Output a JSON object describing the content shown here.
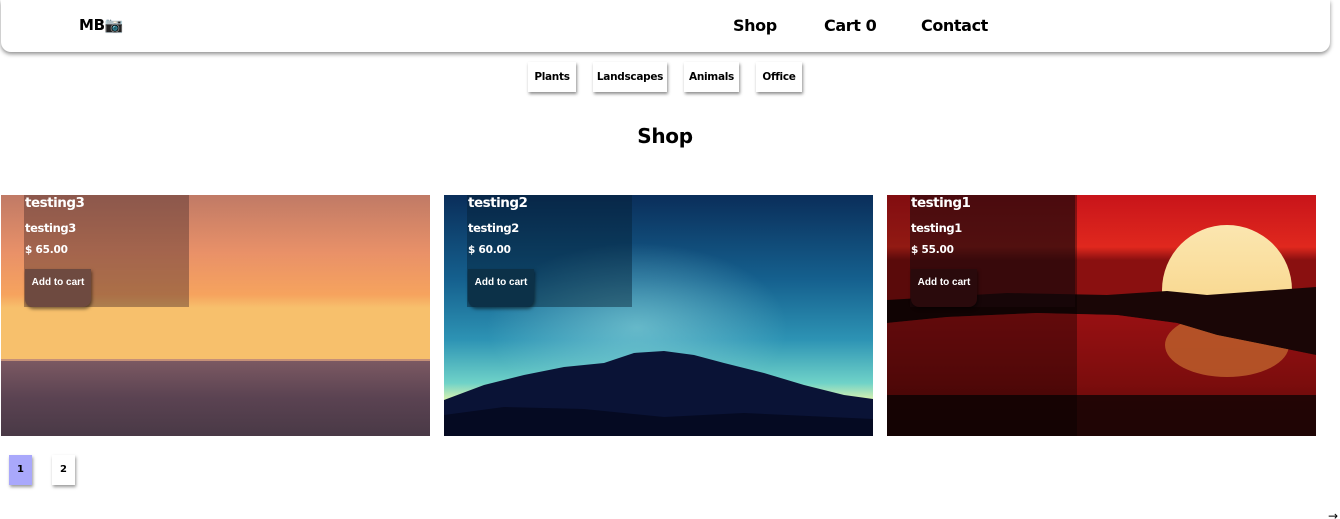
{
  "nav": {
    "brand": "MB",
    "brand_icon": "camera-icon",
    "links": [
      "Shop",
      "Cart 0",
      "Contact"
    ]
  },
  "categories": [
    "Plants",
    "Landscapes",
    "Animals",
    "Office"
  ],
  "page_title": "Shop",
  "products": [
    {
      "title": "testing3",
      "description": "testing3",
      "price": "$ 65.00",
      "button": "Add to cart"
    },
    {
      "title": "testing2",
      "description": "testing2",
      "price": "$ 60.00",
      "button": "Add to cart"
    },
    {
      "title": "testing1",
      "description": "testing1",
      "price": "$ 55.00",
      "button": "Add to cart"
    }
  ],
  "pagination": {
    "pages": [
      "1",
      "2"
    ],
    "active": "1",
    "active_color": "#a9a8fb"
  },
  "corner_arrow": "→"
}
